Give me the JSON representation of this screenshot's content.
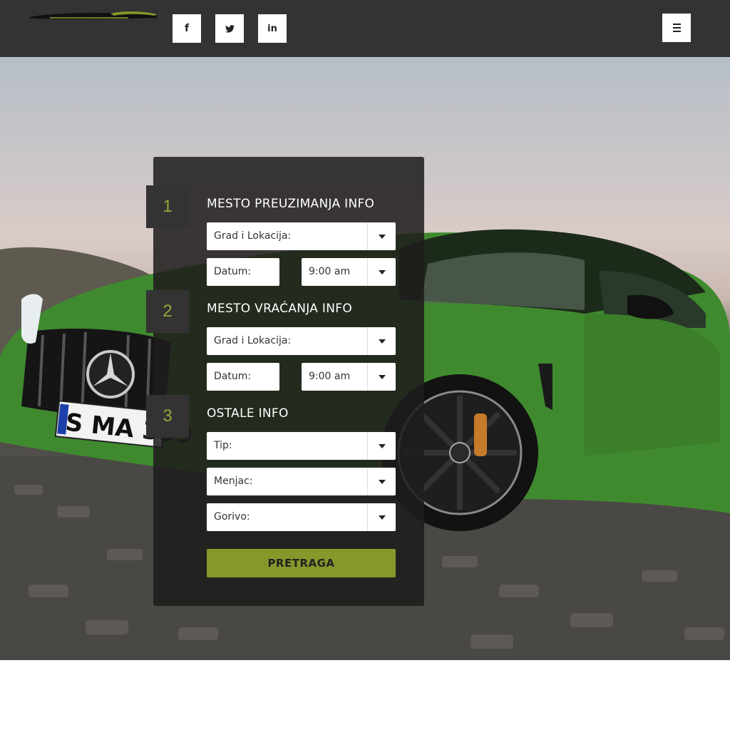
{
  "header": {
    "social": [
      {
        "name": "facebook",
        "glyph": "f"
      },
      {
        "name": "twitter",
        "glyph": "🐦"
      },
      {
        "name": "linkedin",
        "glyph": "in"
      }
    ]
  },
  "colors": {
    "header_bg": "#333333",
    "accent": "#86982a",
    "step_number": "#9aa43a",
    "panel_bg": "#1e1c1c"
  },
  "form": {
    "steps": [
      {
        "number": "1",
        "title": "MESTO PREUZIMANJA INFO",
        "location": "Grad i Lokacija:",
        "date": "Datum:",
        "time": "9:00 am"
      },
      {
        "number": "2",
        "title": "MESTO VRAĆANJA INFO",
        "location": "Grad i Lokacija:",
        "date": "Datum:",
        "time": "9:00 am"
      },
      {
        "number": "3",
        "title": "OSTALE INFO",
        "type": "Tip:",
        "gearbox": "Menjac:",
        "fuel": "Gorivo:"
      }
    ],
    "submit_label": "PRETRAGA"
  }
}
